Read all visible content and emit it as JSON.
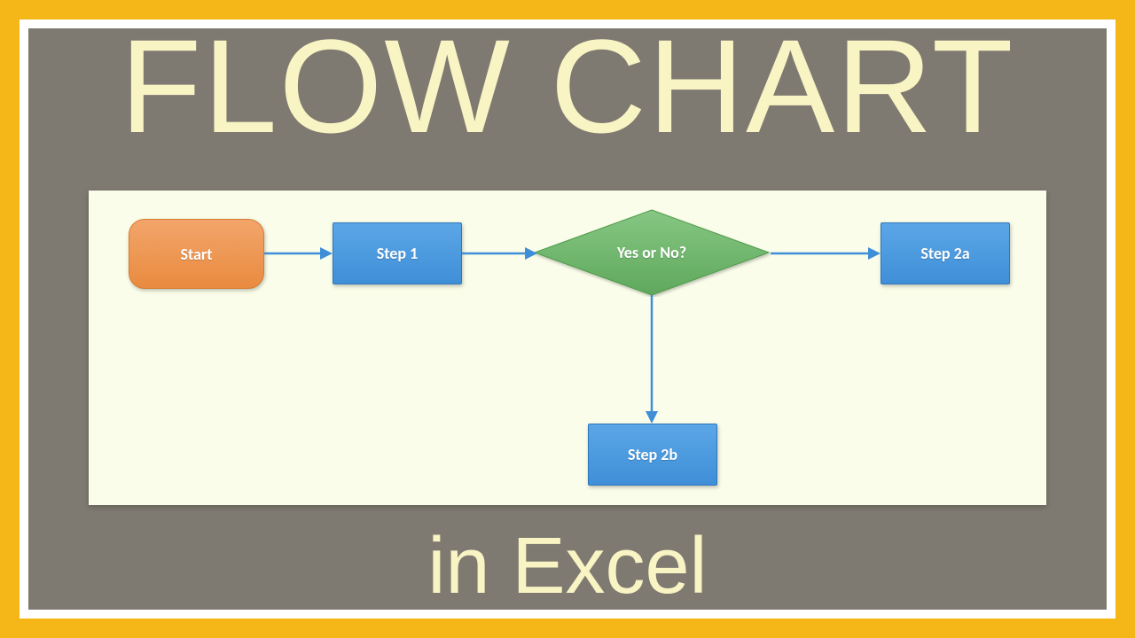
{
  "titles": {
    "top": "FLOW CHART",
    "bottom": "in Excel"
  },
  "flow": {
    "start": {
      "label": "Start"
    },
    "step1": {
      "label": "Step 1"
    },
    "decision": {
      "label": "Yes or No?"
    },
    "step2a": {
      "label": "Step 2a"
    },
    "step2b": {
      "label": "Step 2b"
    }
  },
  "colors": {
    "frame_outer": "#f5b618",
    "frame_inner": "#ffffff",
    "panel": "#7f7a71",
    "canvas": "#fafde9",
    "title_text": "#f9f4c4",
    "terminator": "#e98b40",
    "process": "#3f8fd8",
    "decision": "#6fb46b",
    "arrow": "#3f8fd8"
  }
}
